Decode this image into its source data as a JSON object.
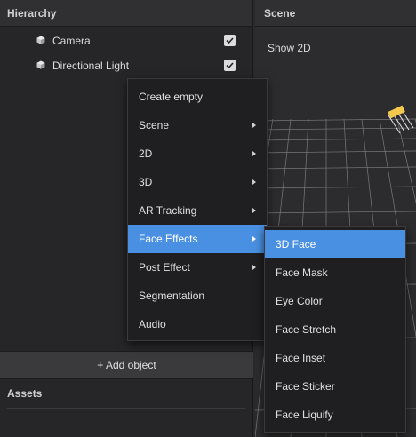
{
  "hierarchy": {
    "title": "Hierarchy",
    "items": [
      {
        "label": "Camera",
        "checked": true,
        "icon": "cube-icon"
      },
      {
        "label": "Directional Light",
        "checked": true,
        "icon": "cube-icon"
      }
    ],
    "add_object_label": "+ Add object"
  },
  "assets": {
    "title": "Assets"
  },
  "scene": {
    "title": "Scene",
    "show_2d_label": "Show 2D"
  },
  "context_menu": {
    "items": [
      {
        "label": "Create empty",
        "submenu": false
      },
      {
        "label": "Scene",
        "submenu": true
      },
      {
        "label": "2D",
        "submenu": true
      },
      {
        "label": "3D",
        "submenu": true
      },
      {
        "label": "AR Tracking",
        "submenu": true
      },
      {
        "label": "Face Effects",
        "submenu": true,
        "active": true
      },
      {
        "label": "Post Effect",
        "submenu": true
      },
      {
        "label": "Segmentation",
        "submenu": false
      },
      {
        "label": "Audio",
        "submenu": false
      }
    ]
  },
  "face_effects_menu": {
    "items": [
      {
        "label": "3D Face",
        "active": true
      },
      {
        "label": "Face Mask"
      },
      {
        "label": "Eye Color"
      },
      {
        "label": "Face Stretch"
      },
      {
        "label": "Face Inset"
      },
      {
        "label": "Face Sticker"
      },
      {
        "label": "Face Liquify"
      }
    ]
  },
  "colors": {
    "accent": "#4a90e2",
    "panel": "#262628",
    "menu": "#1f1f21"
  }
}
